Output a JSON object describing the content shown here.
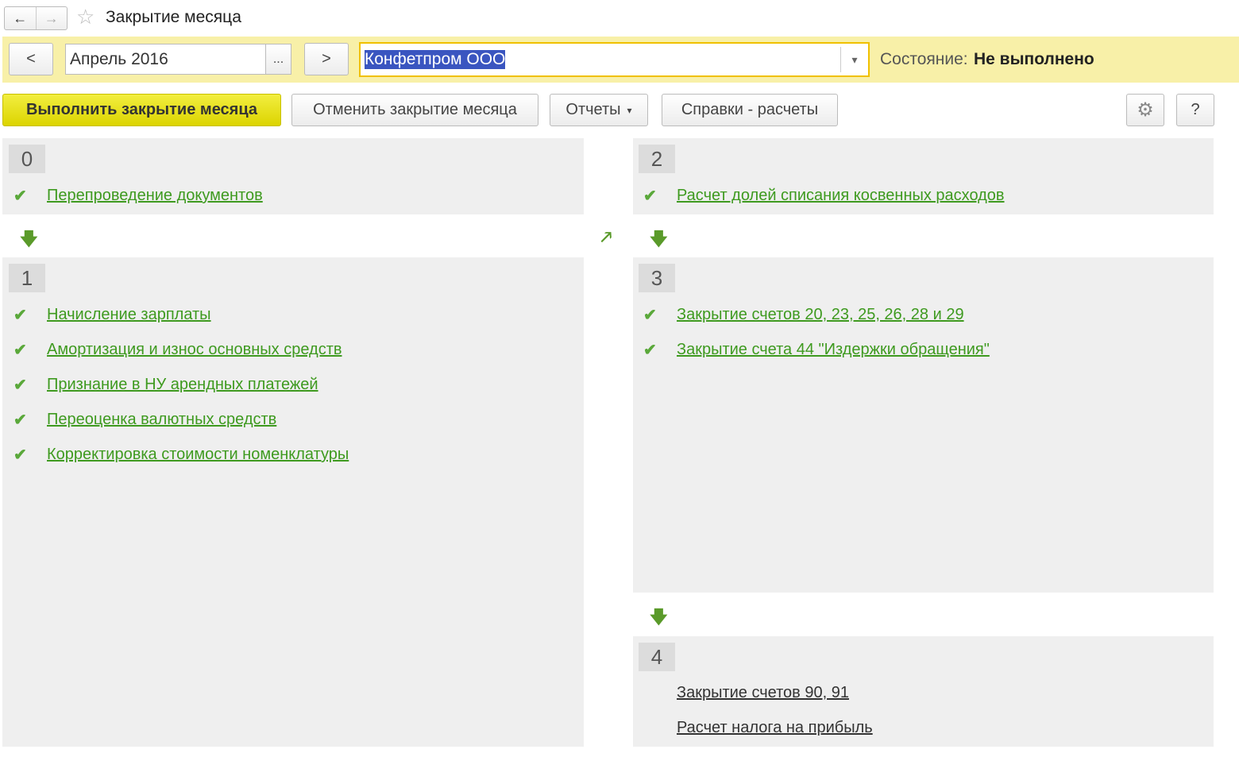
{
  "window": {
    "title": "Закрытие месяца",
    "back": "←",
    "forward": "→",
    "star": "☆"
  },
  "period": {
    "prev": "<",
    "value": "Апрель 2016",
    "select": "...",
    "next": ">"
  },
  "organization": {
    "value": "Конфетпром ООО",
    "dropdown": "▾"
  },
  "status": {
    "label": "Состояние:",
    "value": "Не выполнено"
  },
  "toolbar": {
    "execute": "Выполнить закрытие месяца",
    "cancel": "Отменить закрытие месяца",
    "reports": "Отчеты",
    "reports_arrow": "▾",
    "info": "Справки - расчеты",
    "help": "?"
  },
  "stages": [
    {
      "number": "0",
      "items": [
        {
          "label": "Перепроведение документов",
          "status": "done"
        }
      ]
    },
    {
      "number": "1",
      "items": [
        {
          "label": "Начисление зарплаты",
          "status": "done-edited"
        },
        {
          "label": "Амортизация и износ основных средств",
          "status": "done"
        },
        {
          "label": "Признание в НУ арендных платежей",
          "status": "done"
        },
        {
          "label": "Переоценка валютных средств",
          "status": "done"
        },
        {
          "label": "Корректировка стоимости номенклатуры",
          "status": "done"
        }
      ]
    },
    {
      "number": "2",
      "items": [
        {
          "label": "Расчет долей списания косвенных расходов",
          "status": "done"
        }
      ]
    },
    {
      "number": "3",
      "items": [
        {
          "label": "Закрытие счетов 20, 23, 25, 26, 28 и 29",
          "status": "done"
        },
        {
          "label": "Закрытие счета 44 \"Издержки обращения\"",
          "status": "done"
        }
      ]
    },
    {
      "number": "4",
      "items": [
        {
          "label": "Закрытие счетов 90, 91",
          "status": "pending"
        },
        {
          "label": "Расчет налога на прибыль",
          "status": "pending"
        }
      ]
    }
  ],
  "colors": {
    "accent": "#3e9a1f",
    "execute_button": "#e6e020",
    "status_bar": "#f8f0a8"
  }
}
